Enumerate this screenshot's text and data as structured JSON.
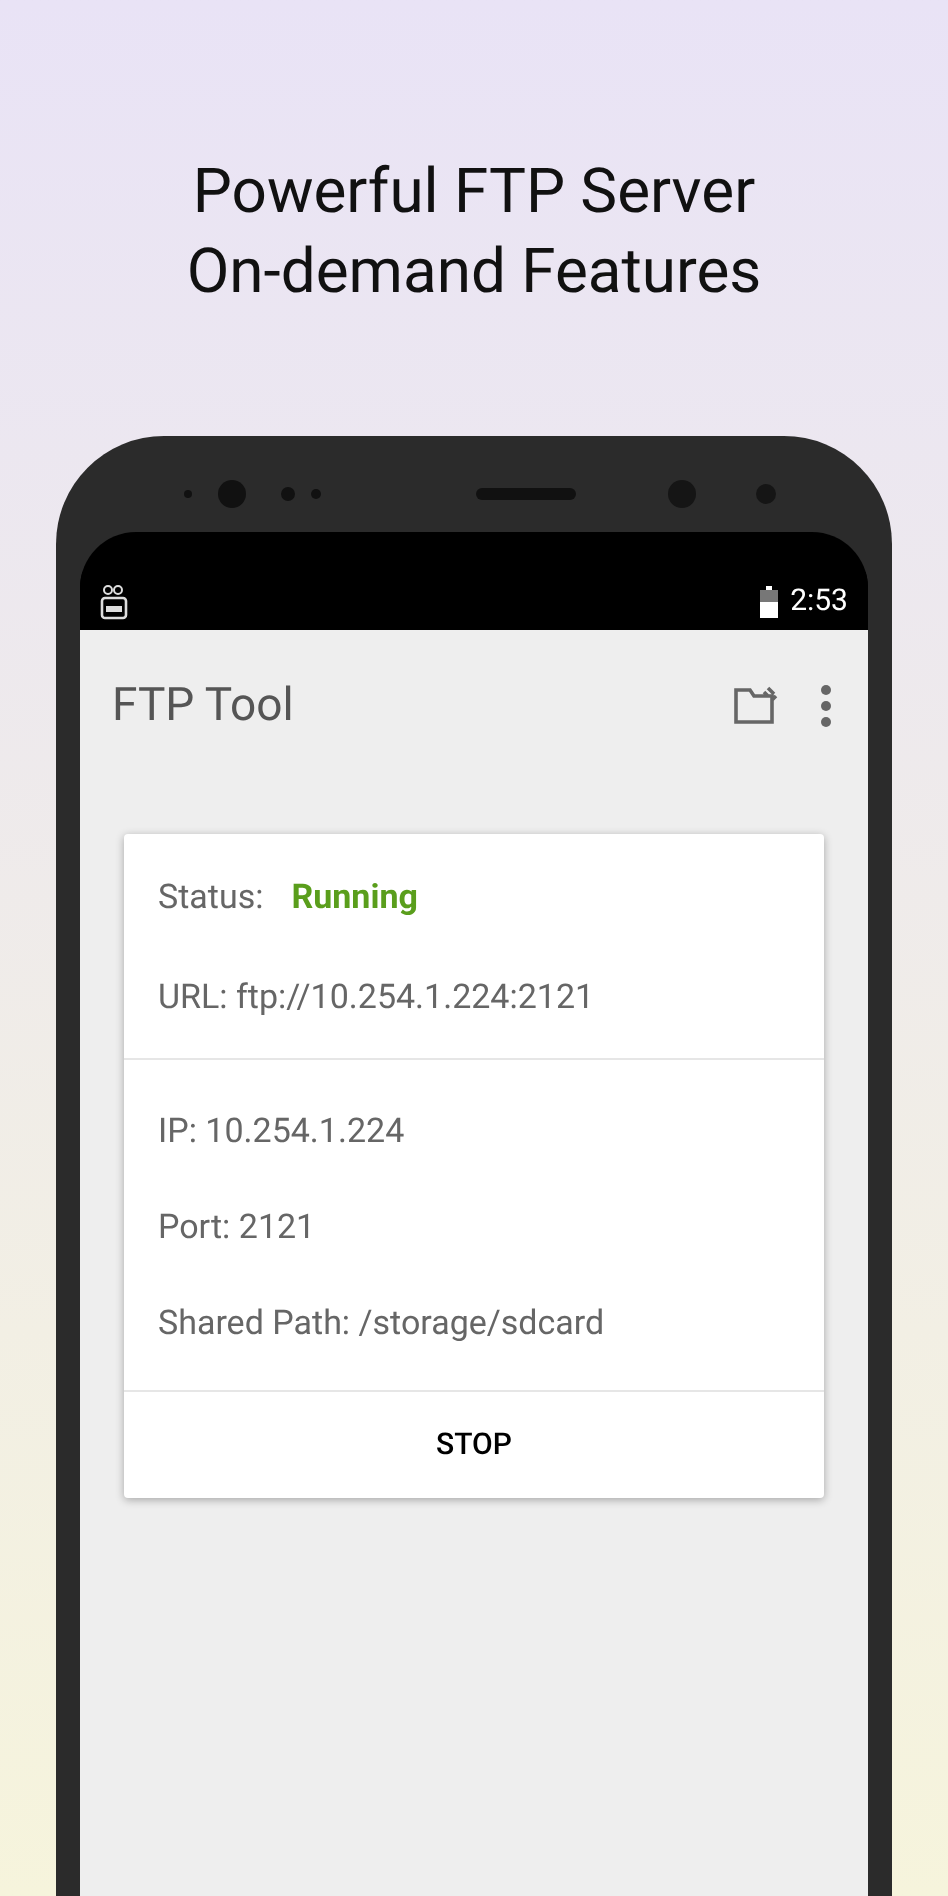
{
  "headline": [
    "Powerful FTP Server",
    "On-demand Features"
  ],
  "status_bar": {
    "time": "2:53"
  },
  "app_bar": {
    "title": "FTP Tool"
  },
  "card": {
    "status_label": "Status:",
    "status_value": "Running",
    "url": "URL: ftp://10.254.1.224:2121",
    "details": [
      "IP: 10.254.1.224",
      "Port: 2121",
      "Shared Path: /storage/sdcard"
    ],
    "button": "STOP"
  }
}
